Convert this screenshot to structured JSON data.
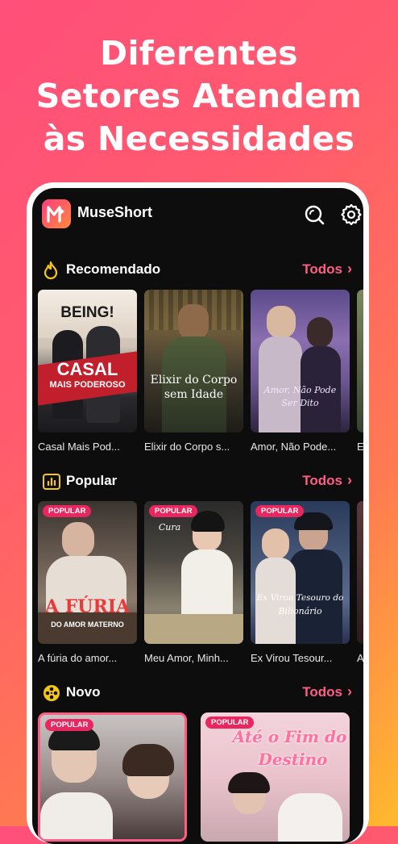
{
  "headline": {
    "line1": "Diferentes",
    "line2": "Setores Atendem",
    "line3": "às Necessidades"
  },
  "app": {
    "title": "MuseShort"
  },
  "sections": {
    "recomendado": {
      "title": "Recomendado",
      "see_all": "Todos",
      "items": [
        {
          "title": "Casal Mais Pod...",
          "poster_text1": "CASAL",
          "poster_text2": "MAIS PODEROSO",
          "poster_top": "BEING!"
        },
        {
          "title": "Elixir do Corpo s...",
          "poster_text1": "Elixir do Corpo",
          "poster_text2": "sem Idade"
        },
        {
          "title": "Amor, Não Pode...",
          "poster_text1": "Amor, Não Pode",
          "poster_text2": "Ser Dito"
        },
        {
          "title": "E"
        }
      ]
    },
    "popular": {
      "title": "Popular",
      "see_all": "Todos",
      "badge": "POPULAR",
      "items": [
        {
          "title": "A fúria do amor...",
          "poster_text1": "A FÚRIA",
          "poster_text2": "DO AMOR MATERNO"
        },
        {
          "title": "Meu Amor, Minh...",
          "poster_text1": "Cura"
        },
        {
          "title": "Ex Virou Tesour...",
          "poster_text1": "Ex Virou Tesouro do",
          "poster_text2": "Bilionário"
        },
        {
          "title": "A"
        }
      ]
    },
    "novo": {
      "title": "Novo",
      "see_all": "Todos",
      "badge": "POPULAR",
      "items": [
        {
          "poster_text1": ""
        },
        {
          "poster_text1": "Até o Fim do",
          "poster_text2": "Destino"
        }
      ]
    }
  },
  "colors": {
    "accent": "#ff5d86",
    "badge": "#e8265f",
    "icon_yellow": "#f5c518"
  }
}
